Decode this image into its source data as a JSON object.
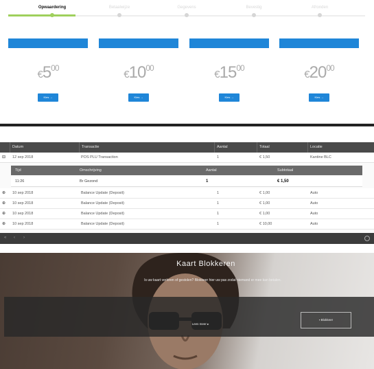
{
  "stepper": {
    "steps": [
      {
        "label": "Opwaardering",
        "active": true
      },
      {
        "label": "Betaalwijze",
        "active": false
      },
      {
        "label": "Gegevens",
        "active": false
      },
      {
        "label": "Bevestig",
        "active": false
      },
      {
        "label": "Afronden",
        "active": false
      }
    ],
    "accent_color": "#9fd05c"
  },
  "amounts": [
    {
      "currency": "€",
      "whole": "5",
      "cents": "00",
      "button_label": "Kies →"
    },
    {
      "currency": "€",
      "whole": "10",
      "cents": "00",
      "button_label": "Kies →"
    },
    {
      "currency": "€",
      "whole": "15",
      "cents": "00",
      "button_label": "Kies →"
    },
    {
      "currency": "€",
      "whole": "20",
      "cents": "00",
      "button_label": "Kies →"
    }
  ],
  "brand_color": "#1f86d8",
  "table": {
    "columns": [
      "Datum",
      "Transactie",
      "Aantal",
      "Totaal",
      "Locatie"
    ],
    "expanded_row": {
      "toggle": "⊟",
      "date": "12 sep 2018",
      "transaction": "POS PLU Transaction",
      "amount": "1",
      "total": "€ 1,50",
      "location": "Kantine BLC"
    },
    "sub_columns": [
      "Tijd",
      "Omschrijving",
      "Aantal",
      "Subtotaal"
    ],
    "sub_row": {
      "time": "11:26",
      "description": "Br Gezond",
      "amount": "1",
      "subtotal": "€ 1,50"
    },
    "rows": [
      {
        "toggle": "⊕",
        "date": "10 sep 2018",
        "transaction": "Balance Update (Deposit)",
        "amount": "1",
        "total": "€ 1,00",
        "location": "Auto"
      },
      {
        "toggle": "⊕",
        "date": "10 sep 2018",
        "transaction": "Balance Update (Deposit)",
        "amount": "1",
        "total": "€ 1,00",
        "location": "Auto"
      },
      {
        "toggle": "⊕",
        "date": "10 sep 2018",
        "transaction": "Balance Update (Deposit)",
        "amount": "1",
        "total": "€ 1,00",
        "location": "Auto"
      },
      {
        "toggle": "⊕",
        "date": "10 sep 2018",
        "transaction": "Balance Update (Deposit)",
        "amount": "1",
        "total": "€ 10,00",
        "location": "Auto"
      }
    ],
    "footer": {
      "first": "«",
      "prev": "‹",
      "next": "›"
    }
  },
  "hero": {
    "title": "Kaart Blokkeren",
    "subtitle": "Is uw kaart verloren of gestolen? Blokkeer hier uw pas zodat niemand er mee kan betalen.",
    "cta_label": "Lees meer ▸",
    "ghost_label": "▪ Blokkeer"
  }
}
